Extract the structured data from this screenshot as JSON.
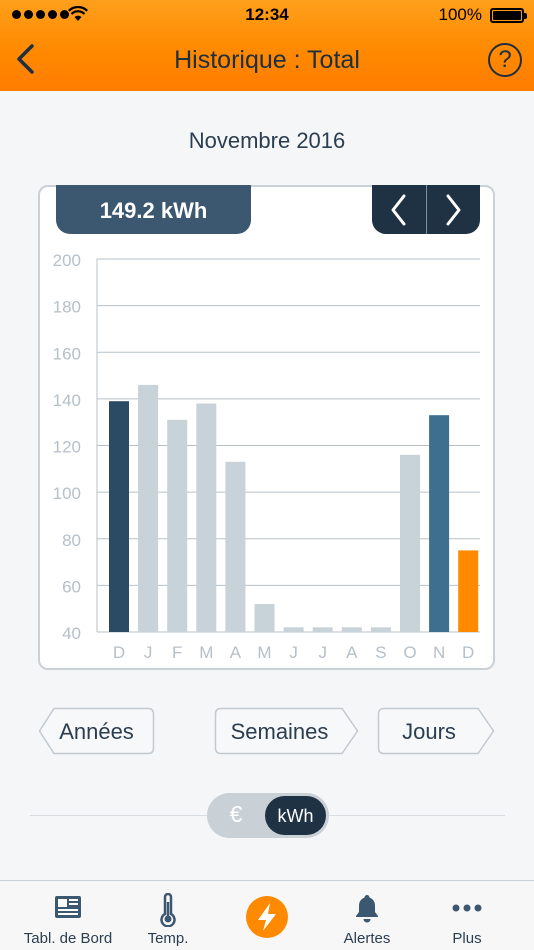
{
  "status_bar": {
    "time": "12:34",
    "battery": "100%"
  },
  "header": {
    "title": "Historique : Total",
    "help_label": "?"
  },
  "period": "Novembre 2016",
  "total": "149.2 kWh",
  "range_buttons": {
    "years": "Années",
    "weeks": "Semaines",
    "days": "Jours"
  },
  "unit_toggle": {
    "euro": "€",
    "kwh": "kWh",
    "selected": "kWh"
  },
  "tabs": [
    {
      "label": "Tabl. de Bord",
      "icon": "dashboard-icon"
    },
    {
      "label": "Temp.",
      "icon": "thermometer-icon"
    },
    {
      "label": "",
      "icon": "lightning-icon"
    },
    {
      "label": "Alertes",
      "icon": "bell-icon"
    },
    {
      "label": "Plus",
      "icon": "more-icon"
    }
  ],
  "colors": {
    "accent": "#ff8a00",
    "dark": "#2b4a63",
    "mid": "#3e6f8e",
    "light": "#c8d2d9",
    "grid": "#b7c0c8"
  },
  "chart_data": {
    "type": "bar",
    "categories": [
      "D",
      "J",
      "F",
      "M",
      "A",
      "M",
      "J",
      "J",
      "A",
      "S",
      "O",
      "N",
      "D"
    ],
    "values": [
      139,
      146,
      131,
      138,
      113,
      52,
      42,
      42,
      42,
      42,
      116,
      133,
      75
    ],
    "bar_colors": [
      "dark",
      "light",
      "light",
      "light",
      "light",
      "light",
      "light",
      "light",
      "light",
      "light",
      "light",
      "mid",
      "accent"
    ],
    "ylim": [
      40,
      200
    ],
    "yticks": [
      40,
      60,
      80,
      100,
      120,
      140,
      160,
      180,
      200
    ],
    "grid": true
  }
}
